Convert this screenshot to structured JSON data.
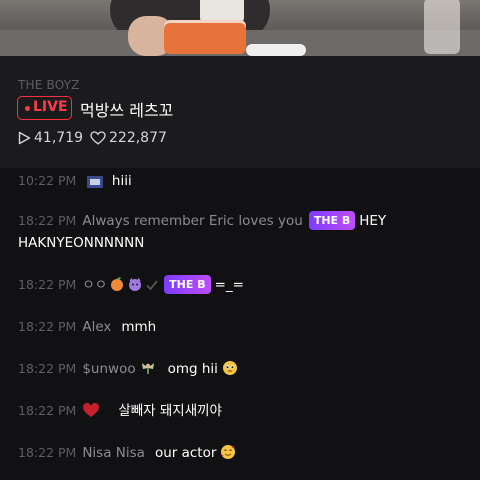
{
  "stream": {
    "channel": "THE BOYZ",
    "live_label": "LIVE",
    "title": "먹방쓰 레츠꼬",
    "plays": "41,719",
    "likes": "222,877"
  },
  "icons": {
    "plays": "play-triangle-icon",
    "likes": "heart-outline-icon",
    "live": "red-dot-icon"
  },
  "colors": {
    "live_red": "#ff3b48",
    "badge_gradient_start": "#7b3cff",
    "badge_gradient_end": "#c04cff",
    "timestamp": "#5d5d64",
    "username": "#8a8a92"
  },
  "chat": {
    "partial": {
      "time": "10:22 PM",
      "text": "hiii"
    },
    "messages": [
      {
        "time": "18:22 PM",
        "user": "Always remember Eric loves you",
        "badge": "THE B",
        "text": "HEY HAKNYEONNNNNN"
      },
      {
        "time": "18:22 PM",
        "user": "ㅇㅇ",
        "badge": "THE B",
        "text": "=_="
      },
      {
        "time": "18:22 PM",
        "user": "Alex",
        "text": "mmh"
      },
      {
        "time": "18:22 PM",
        "user": "$unwoo",
        "text": "omg hii"
      },
      {
        "time": "18:22 PM",
        "user": "",
        "text": "살빼자 돼지새끼야"
      },
      {
        "time": "18:22 PM",
        "user": "Nisa Nisa",
        "text": "our actor"
      }
    ]
  }
}
